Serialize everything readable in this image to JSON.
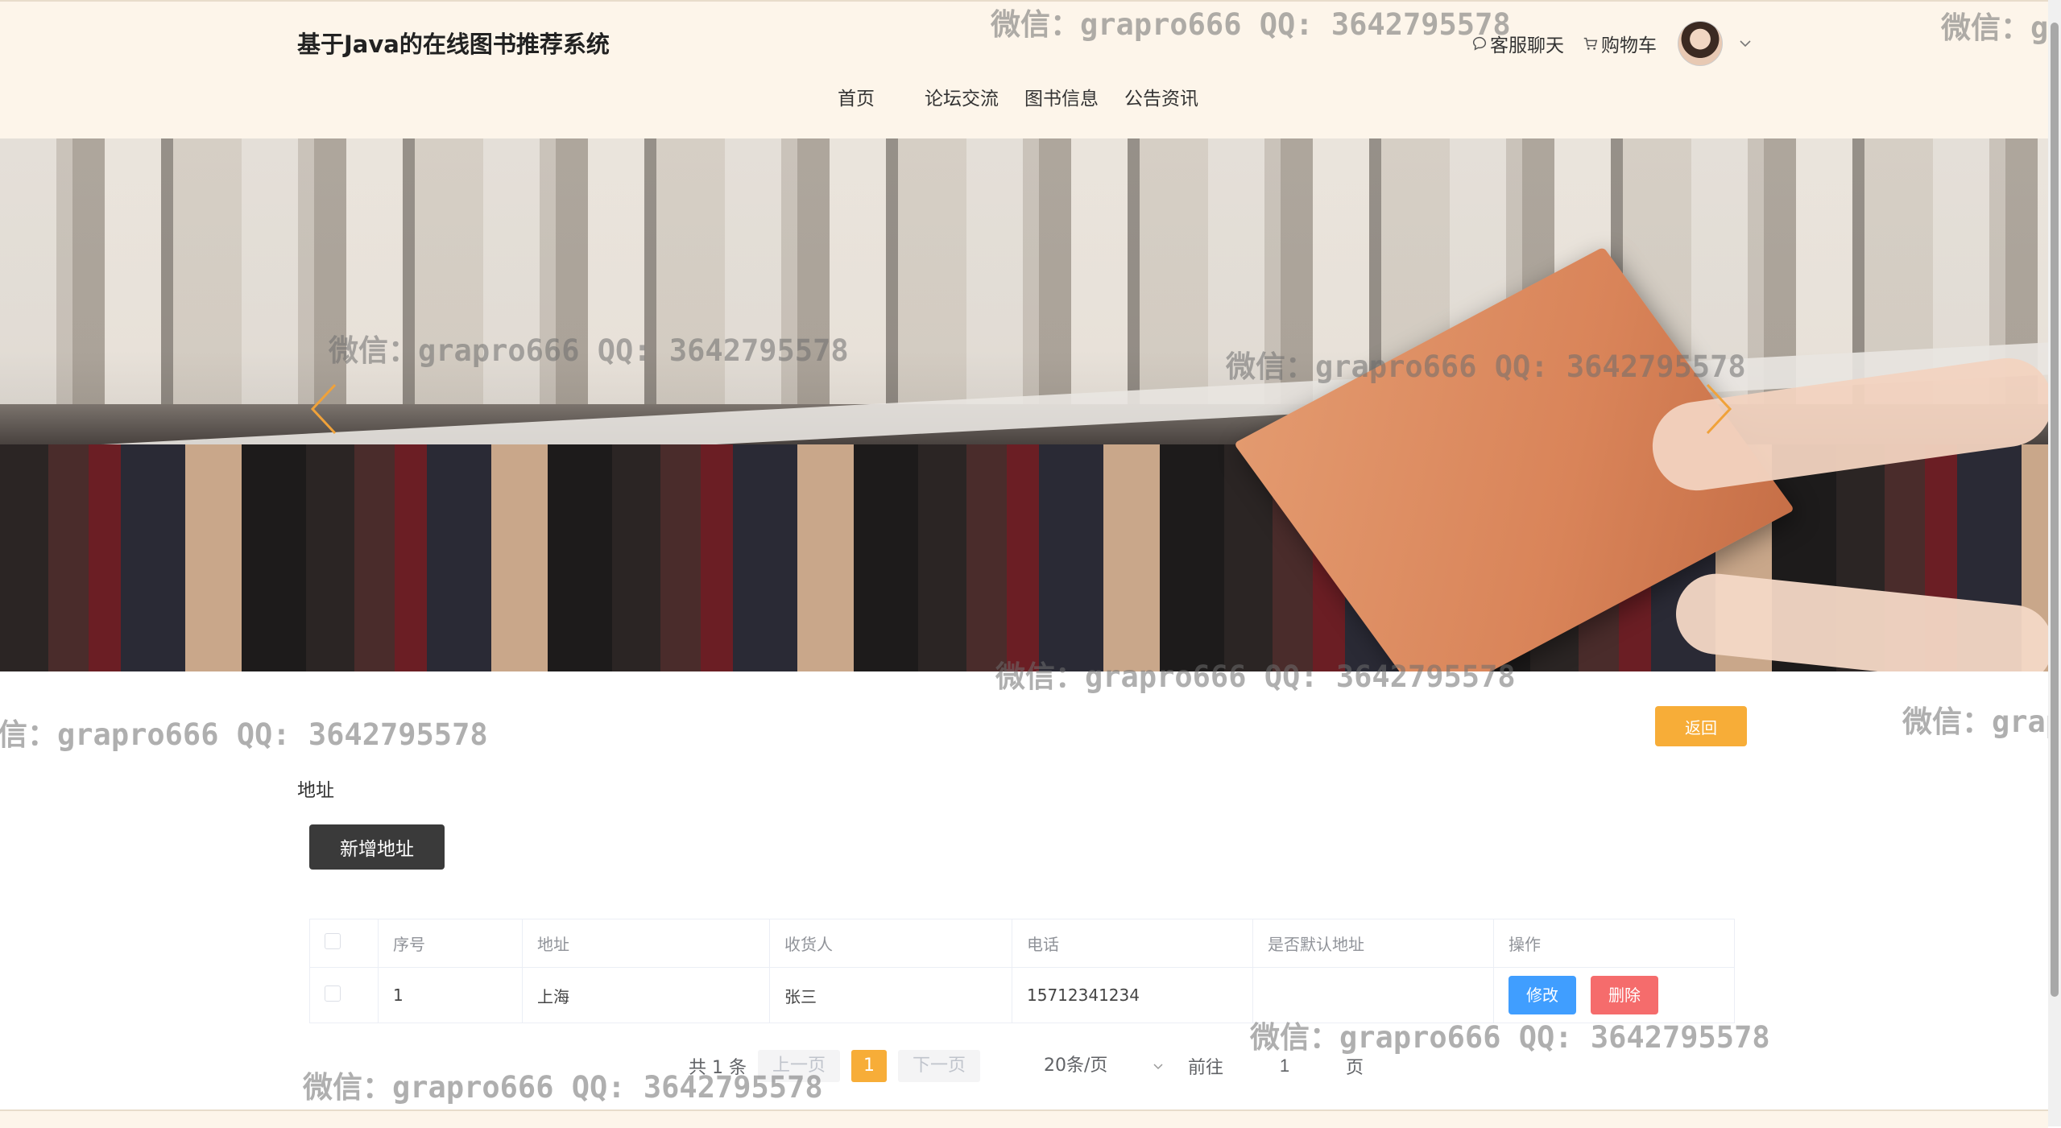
{
  "header": {
    "site_title": "基于Java的在线图书推荐系统",
    "nav": [
      "首页",
      "论坛交流",
      "图书信息",
      "公告资讯"
    ],
    "chat_label": "客服聊天",
    "cart_label": "购物车"
  },
  "banner": {
    "prev_icon": "chevron-left-icon",
    "next_icon": "chevron-right-icon"
  },
  "main": {
    "back_label": "返回",
    "section_label": "地址",
    "add_label": "新增地址"
  },
  "table": {
    "headers": [
      "序号",
      "地址",
      "收货人",
      "电话",
      "是否默认地址",
      "操作"
    ],
    "rows": [
      {
        "index": "1",
        "address": "上海",
        "receiver": "张三",
        "phone": "15712341234",
        "is_default": "",
        "edit_label": "修改",
        "delete_label": "删除"
      }
    ]
  },
  "pagination": {
    "total": "共 1 条",
    "prev_label": "上一页",
    "current_page": "1",
    "next_label": "下一页",
    "page_size": "20条/页",
    "goto_label": "前往",
    "goto_value": "1",
    "page_suffix": "页"
  },
  "watermark_text": "微信：grapro666 QQ: 3642795578",
  "colors": {
    "header_bg": "#fdf5ea",
    "accent": "#f7ad38",
    "primary": "#409eff",
    "danger": "#f56c6c",
    "dark_button": "#3a3a3a"
  }
}
